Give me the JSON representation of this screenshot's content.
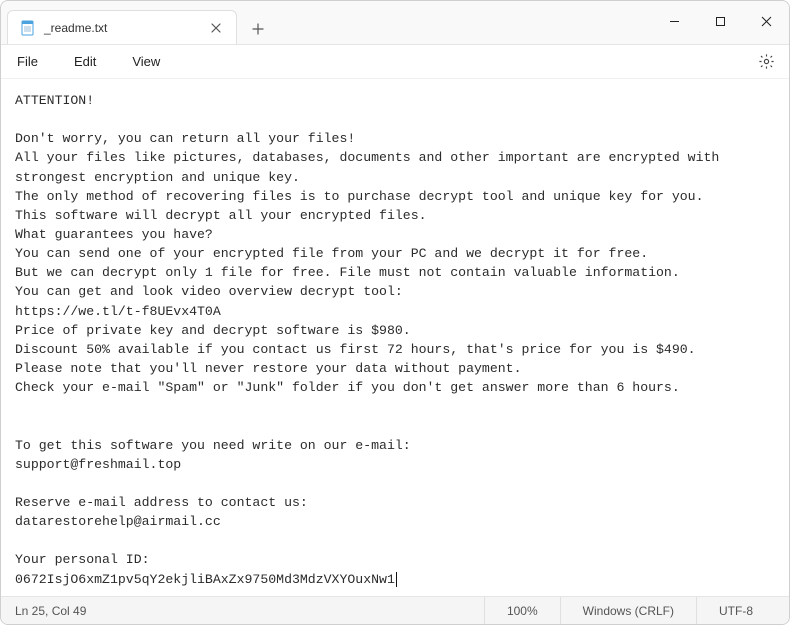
{
  "titlebar": {
    "tab_title": "_readme.txt",
    "notepad_icon": "notepad-icon",
    "close_tab": "✕",
    "new_tab": "＋"
  },
  "menu": {
    "file": "File",
    "edit": "Edit",
    "view": "View"
  },
  "content": {
    "body": "ATTENTION!\n\nDon't worry, you can return all your files!\nAll your files like pictures, databases, documents and other important are encrypted with strongest encryption and unique key.\nThe only method of recovering files is to purchase decrypt tool and unique key for you.\nThis software will decrypt all your encrypted files.\nWhat guarantees you have?\nYou can send one of your encrypted file from your PC and we decrypt it for free.\nBut we can decrypt only 1 file for free. File must not contain valuable information.\nYou can get and look video overview decrypt tool:\nhttps://we.tl/t-f8UEvx4T0A\nPrice of private key and decrypt software is $980.\nDiscount 50% available if you contact us first 72 hours, that's price for you is $490.\nPlease note that you'll never restore your data without payment.\nCheck your e-mail \"Spam\" or \"Junk\" folder if you don't get answer more than 6 hours.\n\n\nTo get this software you need write on our e-mail:\nsupport@freshmail.top\n\nReserve e-mail address to contact us:\ndatarestorehelp@airmail.cc\n\nYour personal ID:\n0672IsjO6xmZ1pv5qY2ekjliBAxZx9750Md3MdzVXYOuxNw1"
  },
  "status": {
    "cursor": "Ln 25, Col 49",
    "zoom": "100%",
    "eol": "Windows (CRLF)",
    "encoding": "UTF-8"
  }
}
